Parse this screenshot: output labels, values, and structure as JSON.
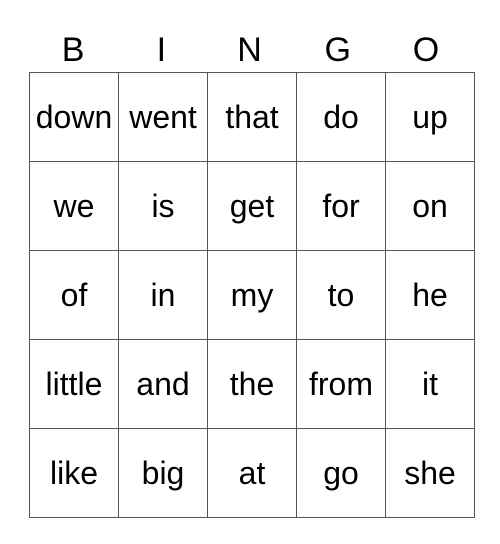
{
  "header": [
    "B",
    "I",
    "N",
    "G",
    "O"
  ],
  "rows": [
    [
      "down",
      "went",
      "that",
      "do",
      "up"
    ],
    [
      "we",
      "is",
      "get",
      "for",
      "on"
    ],
    [
      "of",
      "in",
      "my",
      "to",
      "he"
    ],
    [
      "little",
      "and",
      "the",
      "from",
      "it"
    ],
    [
      "like",
      "big",
      "at",
      "go",
      "she"
    ]
  ]
}
